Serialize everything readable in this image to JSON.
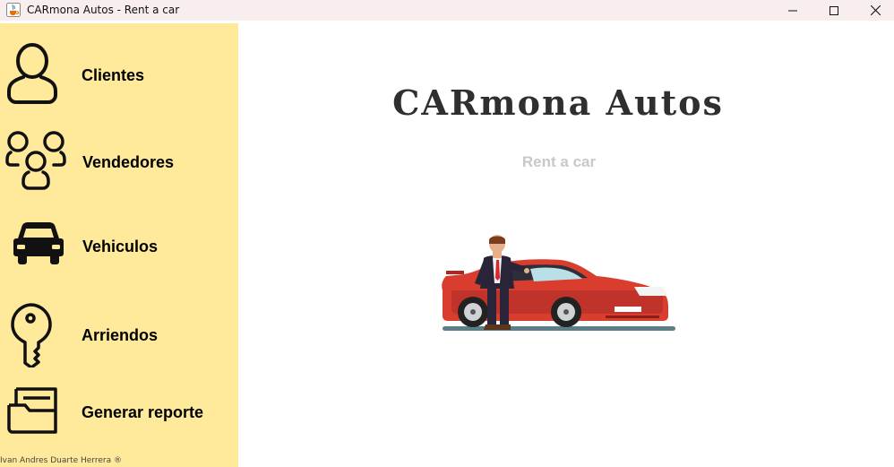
{
  "window": {
    "title": "CARmona Autos - Rent a car",
    "icon": "java-cup-icon"
  },
  "sidebar": {
    "background": "#ffe99b",
    "items": [
      {
        "label": "Clientes",
        "icon": "user-icon"
      },
      {
        "label": "Vendedores",
        "icon": "users-group-icon"
      },
      {
        "label": "Vehiculos",
        "icon": "car-icon"
      },
      {
        "label": "Arriendos",
        "icon": "key-icon"
      },
      {
        "label": "Generar reporte",
        "icon": "folder-icon"
      }
    ],
    "footer": "Ivan Andres Duarte Herrera ®"
  },
  "main": {
    "title": "CARmona Autos",
    "subtitle": "Rent a car",
    "hero_image": "man-with-red-car-illustration"
  }
}
